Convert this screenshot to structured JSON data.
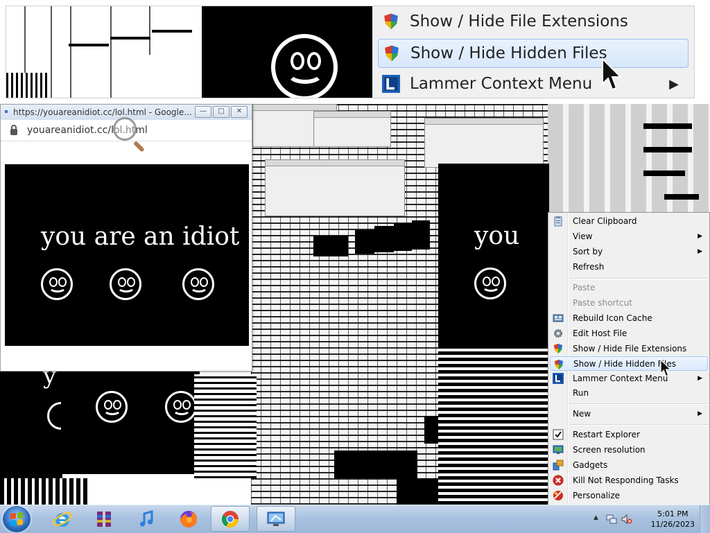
{
  "top_strip_menu": {
    "items": [
      {
        "label": "Show / Hide File Extensions",
        "icon": "shield-icon"
      },
      {
        "label": "Show / Hide Hidden Files",
        "icon": "shield-icon"
      },
      {
        "label": "Lammer Context Menu",
        "icon": "lammer-icon",
        "submenu": true
      }
    ],
    "submenu_arrow": "▶"
  },
  "popup": {
    "title": "https://youareanidiot.cc/lol.html - Google...",
    "url": "youareanidiot.cc/lol.html",
    "message": "you are an idiot",
    "controls": {
      "minimize": "—",
      "maximize": "□",
      "close": "✕"
    }
  },
  "background_panels": {
    "message_fragment": "you",
    "message_fragment_2": "y"
  },
  "context_menu": {
    "items": [
      {
        "label": "Clear Clipboard",
        "icon": "clipboard-icon"
      },
      {
        "label": "View",
        "submenu": true
      },
      {
        "label": "Sort by",
        "submenu": true
      },
      {
        "label": "Refresh"
      },
      {
        "label": "Paste",
        "disabled": true
      },
      {
        "label": "Paste shortcut",
        "disabled": true
      },
      {
        "label": "Rebuild Icon Cache",
        "icon": "icon-cache-icon"
      },
      {
        "label": "Edit Host File",
        "icon": "gear-icon"
      },
      {
        "label": "Show / Hide File Extensions",
        "icon": "shield-icon"
      },
      {
        "label": "Show / Hide Hidden Files",
        "icon": "shield-icon",
        "hover": true
      },
      {
        "label": "Lammer Context Menu",
        "icon": "lammer-icon",
        "submenu": true
      },
      {
        "label": "Run"
      },
      {
        "label": "New",
        "submenu": true
      },
      {
        "label": "Restart Explorer",
        "icon": "checkbox-icon"
      },
      {
        "label": "Screen resolution",
        "icon": "monitor-icon"
      },
      {
        "label": "Gadgets",
        "icon": "gadgets-icon"
      },
      {
        "label": "Kill Not Responding Tasks",
        "icon": "kill-icon"
      },
      {
        "label": "Personalize",
        "icon": "personalize-icon"
      }
    ],
    "submenu_arrow": "▶"
  },
  "taskbar": {
    "apps": [
      {
        "name": "internet-explorer-icon"
      },
      {
        "name": "winrar-icon"
      },
      {
        "name": "itunes-icon"
      },
      {
        "name": "firefox-icon"
      },
      {
        "name": "chrome-icon",
        "active": true
      },
      {
        "name": "remote-desktop-icon",
        "active": true
      }
    ],
    "time": "5:01 PM",
    "date": "11/26/2023"
  },
  "colors": {
    "taskbar": "#a9c2df",
    "menu_bg": "#f0f0f0",
    "hover": "#dbeafc",
    "panel": "#000000"
  }
}
